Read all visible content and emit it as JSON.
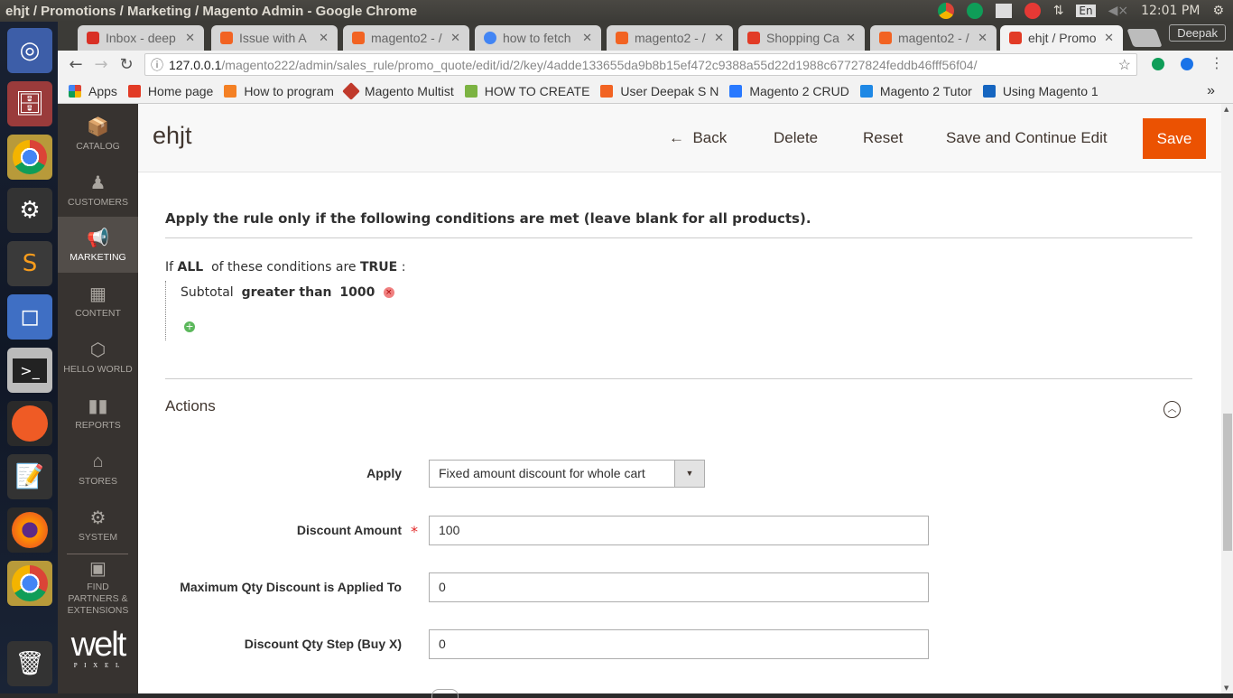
{
  "os": {
    "window_title": "ehjt / Promotions / Marketing / Magento Admin - Google Chrome",
    "time": "12:01 PM",
    "lang": "En"
  },
  "chrome": {
    "tabs": [
      {
        "label": "Inbox - deep",
        "color": "#d93025"
      },
      {
        "label": "Issue with A",
        "color": "#f26322"
      },
      {
        "label": "magento2 - /",
        "color": "#f26322"
      },
      {
        "label": "how to fetch",
        "color": "#4285f4"
      },
      {
        "label": "magento2 - /",
        "color": "#f26322"
      },
      {
        "label": "Shopping Ca",
        "color": "#e23b26"
      },
      {
        "label": "magento2 - /",
        "color": "#f26322"
      },
      {
        "label": "ehjt / Promo",
        "color": "#e23b26",
        "active": true
      }
    ],
    "profile": "Deepak",
    "url_host": "127.0.0.1",
    "url_path": "/magento222/admin/sales_rule/promo_quote/edit/id/2/key/4adde133655da9b8b15ef472c9388a55d22d1988c67727824feddb46fff56f04/",
    "bookmarks": [
      {
        "label": "Apps",
        "color": "#4285f4"
      },
      {
        "label": "Home page",
        "color": "#e23b26"
      },
      {
        "label": "How to program",
        "color": "#f48024"
      },
      {
        "label": "Magento Multist",
        "color": "#c0392b"
      },
      {
        "label": "HOW TO CREATE",
        "color": "#7cb342"
      },
      {
        "label": "User Deepak S N",
        "color": "#f26322"
      },
      {
        "label": "Magento 2 CRUD",
        "color": "#2979ff"
      },
      {
        "label": "Magento 2 Tutor",
        "color": "#1e88e5"
      },
      {
        "label": "Using Magento 1",
        "color": "#1565c0"
      }
    ],
    "more": "»"
  },
  "nav": [
    {
      "label": "CATALOG",
      "icon": "⬢"
    },
    {
      "label": "CUSTOMERS",
      "icon": "♟"
    },
    {
      "label": "MARKETING",
      "icon": "📢",
      "active": true
    },
    {
      "label": "CONTENT",
      "icon": "▦"
    },
    {
      "label": "HELLO WORLD",
      "icon": "⬡"
    },
    {
      "label": "REPORTS",
      "icon": "▮"
    },
    {
      "label": "STORES",
      "icon": "⌂"
    },
    {
      "label": "SYSTEM",
      "icon": "⚙"
    },
    {
      "label": "FIND PARTNERS & EXTENSIONS",
      "icon": "▣"
    }
  ],
  "brand": {
    "name": "welt",
    "sub": "P I X E L"
  },
  "header": {
    "title": "ehjt",
    "back": "Back",
    "delete": "Delete",
    "reset": "Reset",
    "save_continue": "Save and Continue Edit",
    "save": "Save"
  },
  "conditions": {
    "heading": "Apply the rule only if the following conditions are met (leave blank for all products).",
    "if": "If",
    "all": "ALL",
    "mid": "of these conditions are",
    "true": "TRUE",
    "colon": ":",
    "rule_attr": "Subtotal",
    "rule_op": "greater than",
    "rule_val": "1000"
  },
  "actions": {
    "title": "Actions",
    "apply_label": "Apply",
    "apply_value": "Fixed amount discount for whole cart",
    "discount_label": "Discount Amount",
    "discount_value": "100",
    "maxqty_label": "Maximum Qty Discount is Applied To",
    "maxqty_value": "0",
    "step_label": "Discount Qty Step (Buy X)",
    "step_value": "0"
  }
}
